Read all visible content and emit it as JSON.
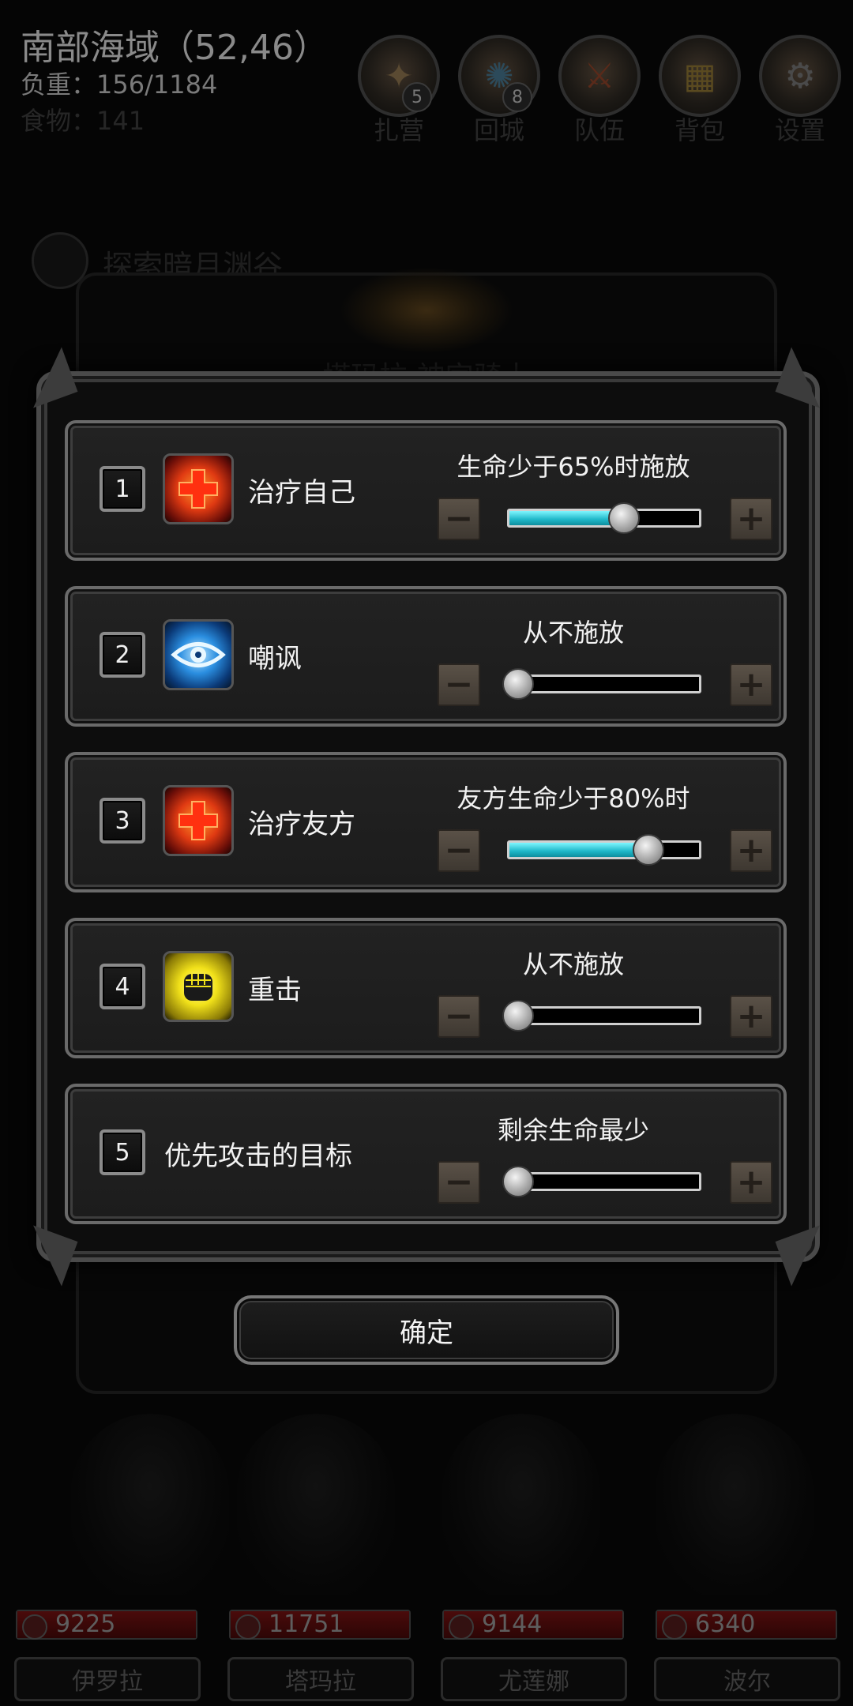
{
  "hud": {
    "location": "南部海域（52,46）",
    "load": "负重：156/1184",
    "food": "食物：141",
    "buttons": [
      {
        "label": "扎营",
        "badge": "5",
        "icon": "camp-fire-icon"
      },
      {
        "label": "回城",
        "badge": "8",
        "icon": "portal-icon"
      },
      {
        "label": "队伍",
        "badge": "",
        "icon": "team-icon"
      },
      {
        "label": "背包",
        "badge": "",
        "icon": "backpack-icon"
      },
      {
        "label": "设置",
        "badge": "",
        "icon": "gear-icon"
      }
    ]
  },
  "background": {
    "quest": "探索暗月渊谷",
    "hero_title": "塔玛拉 神宫骑士"
  },
  "dialog": {
    "rows": [
      {
        "index": "1",
        "name": "治疗自己",
        "icon": "heal-cross-icon",
        "condition": "生命少于65%时施放",
        "level": 0.65
      },
      {
        "index": "2",
        "name": "嘲讽",
        "icon": "taunt-eye-icon",
        "condition": "从不施放",
        "level": 0
      },
      {
        "index": "3",
        "name": "治疗友方",
        "icon": "heal-cross-icon",
        "condition": "友方生命少于80%时",
        "level": 0.8
      },
      {
        "index": "4",
        "name": "重击",
        "icon": "fist-smash-icon",
        "condition": "从不施放",
        "level": 0
      },
      {
        "index": "5",
        "name": "优先攻击的目标",
        "icon": "",
        "condition": "剩余生命最少",
        "level": 0
      }
    ],
    "minus": "−",
    "plus": "+",
    "confirm": "确定"
  },
  "party": [
    {
      "name": "伊罗拉",
      "hp": "9225"
    },
    {
      "name": "塔玛拉",
      "hp": "11751"
    },
    {
      "name": "尤莲娜",
      "hp": "9144"
    },
    {
      "name": "波尔",
      "hp": "6340"
    }
  ]
}
